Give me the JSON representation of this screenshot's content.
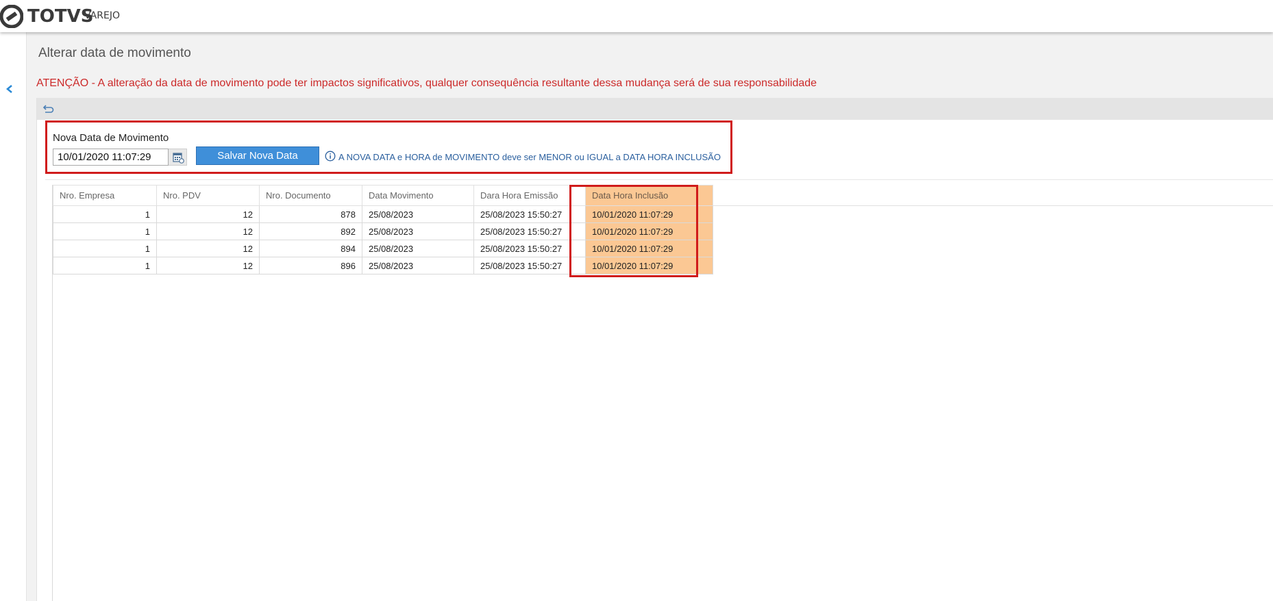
{
  "app": {
    "brand": "TOTVS",
    "product": "VAREJO"
  },
  "page": {
    "title": "Alterar data de movimento",
    "warning": "ATENÇÃO - A alteração da data de movimento pode ter impactos significativos, qualquer consequência resultante dessa mudança será de sua responsabilidade"
  },
  "form": {
    "label": "Nova Data de Movimento",
    "date_value": "10/01/2020 11:07:29",
    "save_label": "Salvar Nova Data",
    "info_text": "A NOVA DATA e HORA de MOVIMENTO deve ser MENOR ou IGUAL a DATA HORA INCLUSÃO"
  },
  "table": {
    "columns": [
      "Nro. Empresa",
      "Nro. PDV",
      "Nro. Documento",
      "Data Movimento",
      "Dara Hora Emissão",
      "Data Hora Inclusão"
    ],
    "rows": [
      [
        "1",
        "12",
        "878",
        "25/08/2023",
        "25/08/2023 15:50:27",
        "10/01/2020 11:07:29"
      ],
      [
        "1",
        "12",
        "892",
        "25/08/2023",
        "25/08/2023 15:50:27",
        "10/01/2020 11:07:29"
      ],
      [
        "1",
        "12",
        "894",
        "25/08/2023",
        "25/08/2023 15:50:27",
        "10/01/2020 11:07:29"
      ],
      [
        "1",
        "12",
        "896",
        "25/08/2023",
        "25/08/2023 15:50:27",
        "10/01/2020 11:07:29"
      ]
    ]
  },
  "colors": {
    "accent": "#3f8fd9",
    "warning": "#cc2a2a",
    "highlight": "#fbc894",
    "annotation": "#d01b1b"
  }
}
